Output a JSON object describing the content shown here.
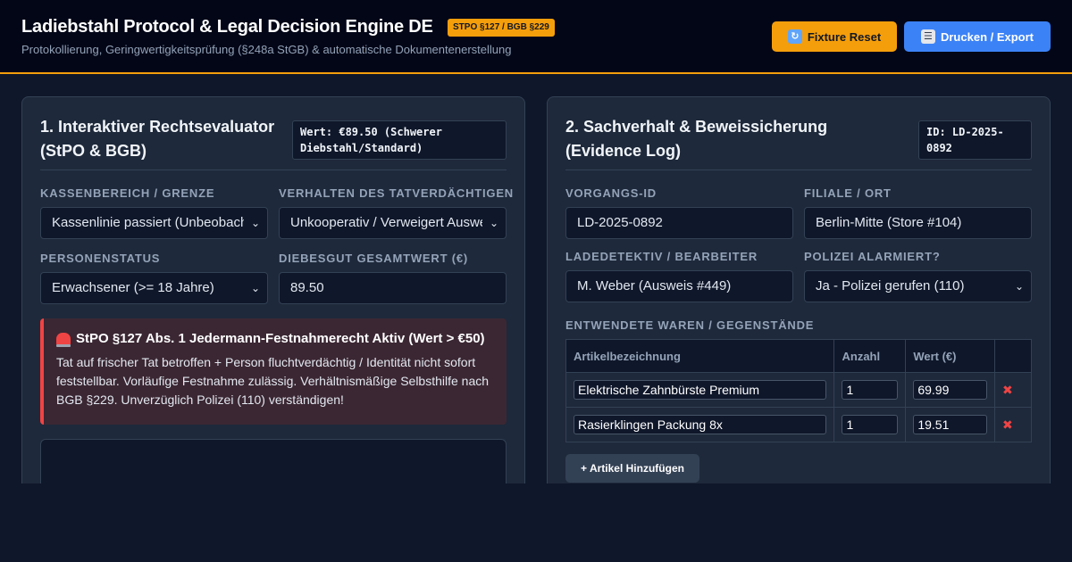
{
  "header": {
    "title": "Ladiebstahl Protocol & Legal Decision Engine DE",
    "badge": "STPO §127 / BGB §229",
    "subtitle": "Protokollierung, Geringwertigkeitsprüfung (§248a StGB) & automatische Dokumentenerstellung",
    "reset_label": "Fixture Reset",
    "export_label": "Drucken / Export",
    "reset_icon": "refresh-icon",
    "export_icon": "document-icon"
  },
  "evaluator": {
    "title": "1. Interaktiver Rechtsevaluator (StPO & BGB)",
    "value_tag": "Wert: €89.50 (Schwerer Diebstahl/Standard)",
    "kasse_label": "KASSENBEREICH / GRENZE",
    "kasse_value": "Kassenlinie passiert (Unbeobachtet)",
    "verhalten_label": "VERHALTEN DES TATVERDÄCHTIGEN",
    "verhalten_value": "Unkooperativ / Verweigert Ausweis",
    "person_label": "PERSONENSTATUS",
    "person_value": "Erwachsener (>= 18 Jahre)",
    "wert_label": "DIEBESGUT GESAMTWERT (€)",
    "wert_value": "89.50",
    "alert_title": "StPO §127 Abs. 1 Jedermann-Festnahmerecht Aktiv (Wert > €50)",
    "alert_text": "Tat auf frischer Tat betroffen + Person fluchtverdächtig / Identität nicht sofort feststellbar. Vorläufige Festnahme zulässig. Verhältnismäßige Selbsthilfe nach BGB §229. Unverzüglich Polizei (110) verständigen!"
  },
  "evidence": {
    "title": "2. Sachverhalt & Beweissicherung (Evidence Log)",
    "id_tag": "ID: LD-2025-0892",
    "vorgang_label": "VORGANGS-ID",
    "vorgang_value": "LD-2025-0892",
    "filiale_label": "FILIALE / ORT",
    "filiale_value": "Berlin-Mitte (Store #104)",
    "detektiv_label": "LADEDETEKTIV / BEARBEITER",
    "detektiv_value": "M. Weber (Ausweis #449)",
    "polizei_label": "POLIZEI ALARMIERT?",
    "polizei_value": "Ja - Polizei gerufen (110)",
    "waren_label": "ENTWENDETE WAREN / GEGENSTÄNDE",
    "columns": [
      "Artikelbezeichnung",
      "Anzahl",
      "Wert (€)",
      ""
    ],
    "rows": [
      {
        "name": "Elektrische Zahnbürste Premium",
        "qty": "1",
        "value": "69.99"
      },
      {
        "name": "Rasierklingen Packung 8x",
        "qty": "1",
        "value": "19.51"
      }
    ],
    "add_label": "+ Artikel Hinzufügen"
  },
  "colors": {
    "accent": "#f59e0b",
    "primary": "#3b82f6",
    "danger": "#ef4444",
    "background": "#0f172a",
    "panel": "#1e293b"
  }
}
